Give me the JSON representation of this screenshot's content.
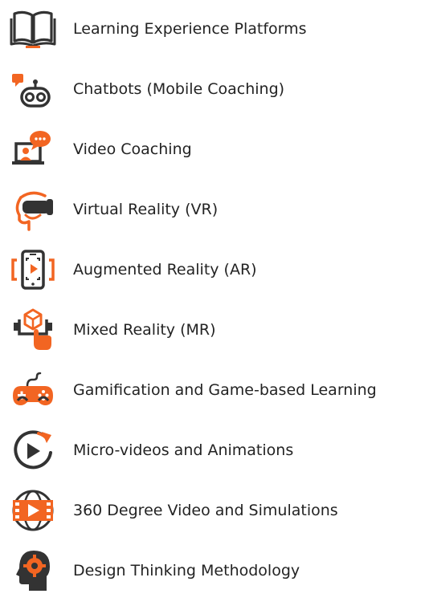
{
  "colors": {
    "accent": "#f26522",
    "dark": "#333333",
    "text": "#232323"
  },
  "items": [
    {
      "label": "Learning Experience Platforms",
      "icon": "open-book-icon"
    },
    {
      "label": "Chatbots (Mobile Coaching)",
      "icon": "chatbot-icon"
    },
    {
      "label": "Video Coaching",
      "icon": "video-coaching-icon"
    },
    {
      "label": "Virtual Reality (VR)",
      "icon": "vr-headset-icon"
    },
    {
      "label": "Augmented Reality (AR)",
      "icon": "ar-phone-icon"
    },
    {
      "label": "Mixed Reality (MR)",
      "icon": "mixed-reality-icon"
    },
    {
      "label": "Gamification and Game-based Learning",
      "icon": "gamepad-icon"
    },
    {
      "label": "Micro-videos and Animations",
      "icon": "replay-play-icon"
    },
    {
      "label": "360 Degree Video and Simulations",
      "icon": "globe-film-icon"
    },
    {
      "label": "Design Thinking Methodology",
      "icon": "head-gear-icon"
    }
  ]
}
